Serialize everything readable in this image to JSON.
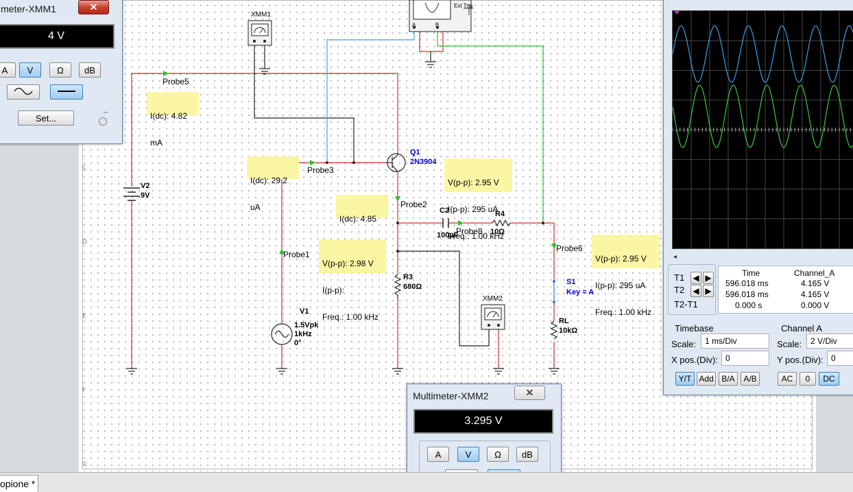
{
  "workspace": {
    "zone_labels": [
      "C",
      "D",
      "E",
      "F",
      "G"
    ],
    "document_tab": "opione *"
  },
  "components": {
    "xmm1_ref": "XMM1",
    "xmm2_ref": "XMM2",
    "q1_ref": "Q1",
    "q1_model": "2N3904",
    "v2_ref": "V2",
    "v2_value": "9V",
    "v1_ref": "V1",
    "v1_amp": "1.5Vpk",
    "v1_freq": "1kHz",
    "v1_phase": "0°",
    "c2_ref": "C2",
    "c2_value": "100µF",
    "r4_ref": "R4",
    "r4_value": "10Ω",
    "r3_ref": "R3",
    "r3_value": "680Ω",
    "rl_ref": "RL",
    "rl_value": "10kΩ",
    "s1_ref": "S1",
    "s1_key": "Key = A",
    "oscilloscope_ext_trig": "Ext Trig",
    "oscilloscope_a": "A",
    "oscilloscope_b": "B"
  },
  "probes": {
    "probe5": {
      "name": "Probe5",
      "lines": [
        "I(dc): 4.82",
        "mA"
      ]
    },
    "probe3": {
      "name": "Probe3",
      "lines": [
        "I(dc): 29.2",
        "uA"
      ]
    },
    "probe2": {
      "name": "Probe2",
      "lines": [
        "I(dc): 4.85",
        "mA"
      ]
    },
    "probe1": {
      "name": "Probe1",
      "lines": [
        "V(p-p): 2.98 V",
        "I(p-p):",
        "Freq.: 1.00 kHz"
      ]
    },
    "probe_q1": {
      "lines": [
        "V(p-p): 2.95 V",
        "I(p-p): 295 uA",
        "Freq.: 1.00 kHz"
      ]
    },
    "probe6": {
      "name": "Probe6",
      "lines": [
        "V(p-p): 2.95 V",
        "I(p-p): 295 uA",
        "Freq.: 1.00 kHz"
      ]
    },
    "probe8": {
      "name": "Probe8"
    }
  },
  "multimeter1": {
    "title": "meter-XMM1",
    "display": "4 V",
    "buttons": [
      "A",
      "V",
      "Ω",
      "dB"
    ],
    "active": "V",
    "set_label": "Set..."
  },
  "multimeter2": {
    "title": "Multimeter-XMM2",
    "display": "3.295 V",
    "buttons": [
      "A",
      "V",
      "Ω",
      "dB"
    ],
    "active": "V"
  },
  "oscilloscope": {
    "cursor_table": {
      "header_time": "Time",
      "header_channel": "Channel_A",
      "t1_label": "T1",
      "t2_label": "T2",
      "t2t1_label": "T2-T1",
      "t1_time": "596.018 ms",
      "t1_value": "4.165 V",
      "t2_time": "596.018 ms",
      "t2_value": "4.165 V",
      "diff_time": "0.000 s",
      "diff_value": "0.000 V"
    },
    "timebase": {
      "title": "Timebase",
      "scale_label": "Scale:",
      "scale_value": "1 ms/Div",
      "xpos_label": "X pos.(Div):",
      "xpos_value": "0",
      "buttons": [
        "Y/T",
        "Add",
        "B/A",
        "A/B"
      ],
      "active": "Y/T"
    },
    "channel_a": {
      "title": "Channel A",
      "scale_label": "Scale:",
      "scale_value": "2  V/Div",
      "ypos_label": "Y pos.(Div):",
      "ypos_value": "0",
      "buttons": [
        "AC",
        "0",
        "DC"
      ],
      "active": "DC"
    },
    "waveforms": {
      "channel_a_color": "#3aa0e8",
      "channel_b_color": "#3ec83e",
      "cycles_shown": 5.5
    }
  },
  "colors": {
    "wire_red": "#d22a2a",
    "wire_black": "#222222",
    "wire_blue": "#3f9fe0",
    "wire_green": "#2fbf2f",
    "probe_bg": "#fbf6a4",
    "ref_blue": "#0000cc"
  }
}
